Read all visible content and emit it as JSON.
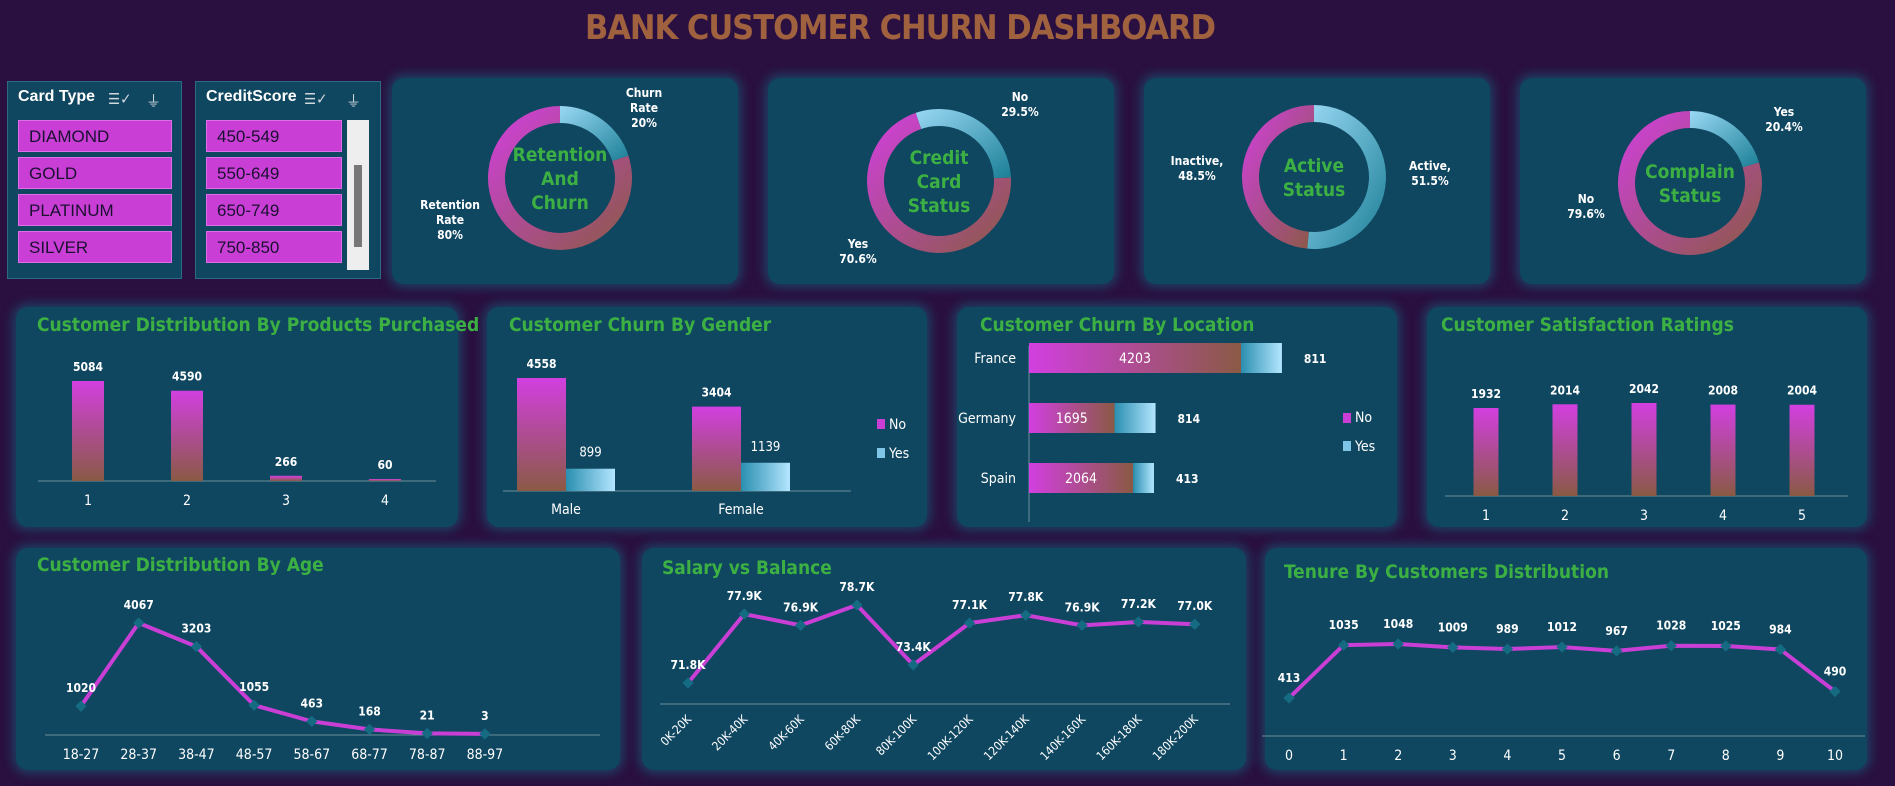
{
  "title": "BANK CUSTOMER CHURN DASHBOARD",
  "colors": {
    "background": "#2a1040",
    "card": "#0f4660",
    "title": "#a0613f",
    "chart_title": "#3cb043",
    "magenta": "#c93fd6",
    "blue": "#9ad8f5",
    "line": "#c93fd6",
    "marker": "#156b82"
  },
  "slicers": [
    {
      "title": "Card Type",
      "items": [
        "DIAMOND",
        "GOLD",
        "PLATINUM",
        "SILVER"
      ]
    },
    {
      "title": "CreditScore",
      "items": [
        "450-549",
        "550-649",
        "650-749",
        "750-850"
      ]
    }
  ],
  "chart_data": [
    {
      "type": "pie",
      "id": "retention",
      "center_title": [
        "Retention",
        "And",
        "Churn"
      ],
      "labels": [
        {
          "name": "Churn",
          "sub": "Rate",
          "value": "20%"
        },
        {
          "name": "Retention",
          "sub": "Rate",
          "value": "80%"
        }
      ],
      "values": [
        20,
        80
      ]
    },
    {
      "type": "pie",
      "id": "creditcard",
      "center_title": [
        "Credit",
        "Card",
        "Status"
      ],
      "labels": [
        {
          "name": "No",
          "value": "29.5%"
        },
        {
          "name": "Yes",
          "value": "70.6%"
        }
      ],
      "values": [
        29.5,
        70.6
      ]
    },
    {
      "type": "pie",
      "id": "active",
      "center_title": [
        "Active",
        "Status"
      ],
      "labels": [
        {
          "name": "Active,",
          "value": "51.5%"
        },
        {
          "name": "Inactive,",
          "value": "48.5%"
        }
      ],
      "values": [
        51.5,
        48.5
      ]
    },
    {
      "type": "pie",
      "id": "complain",
      "center_title": [
        "Complain",
        "Status"
      ],
      "labels": [
        {
          "name": "Yes",
          "value": "20.4%"
        },
        {
          "name": "No",
          "value": "79.6%"
        }
      ],
      "values": [
        20.4,
        79.6
      ]
    },
    {
      "type": "bar",
      "id": "products",
      "title": "Customer Distribution By Products Purchased",
      "categories": [
        "1",
        "2",
        "3",
        "4"
      ],
      "values": [
        5084,
        4590,
        266,
        60
      ]
    },
    {
      "type": "bar",
      "id": "gender",
      "title": "Customer Churn By Gender",
      "categories": [
        "Male",
        "Female"
      ],
      "series": [
        {
          "name": "No",
          "values": [
            4558,
            3404
          ]
        },
        {
          "name": "Yes",
          "values": [
            899,
            1139
          ]
        }
      ]
    },
    {
      "type": "bar",
      "id": "location",
      "title": "Customer Churn By Location",
      "orientation": "horizontal",
      "categories": [
        "France",
        "Germany",
        "Spain"
      ],
      "series": [
        {
          "name": "No",
          "values": [
            4203,
            1695,
            2064
          ]
        },
        {
          "name": "Yes",
          "values": [
            811,
            814,
            413
          ]
        }
      ]
    },
    {
      "type": "bar",
      "id": "satisfaction",
      "title": "Customer Satisfaction Ratings",
      "categories": [
        "1",
        "2",
        "3",
        "4",
        "5"
      ],
      "values": [
        1932,
        2014,
        2042,
        2008,
        2004
      ]
    },
    {
      "type": "line",
      "id": "age",
      "title": "Customer Distribution By Age",
      "categories": [
        "18-27",
        "28-37",
        "38-47",
        "48-57",
        "58-67",
        "68-77",
        "78-87",
        "88-97"
      ],
      "values": [
        1020,
        4067,
        3203,
        1055,
        463,
        168,
        21,
        3
      ]
    },
    {
      "type": "line",
      "id": "salary",
      "title": "Salary vs Balance",
      "categories": [
        "0K-20K",
        "20K-40K",
        "40K-60K",
        "60K-80K",
        "80K-100K",
        "100K-120K",
        "120K-140K",
        "140K-160K",
        "160K-180K",
        "180K-200K"
      ],
      "values": [
        71.8,
        77.9,
        76.9,
        78.7,
        73.4,
        77.1,
        77.8,
        76.9,
        77.2,
        77.0
      ],
      "labels": [
        "71.8K",
        "77.9K",
        "76.9K",
        "78.7K",
        "73.4K",
        "77.1K",
        "77.8K",
        "76.9K",
        "77.2K",
        "77.0K"
      ]
    },
    {
      "type": "line",
      "id": "tenure",
      "title": "Tenure By Customers Distribution",
      "categories": [
        "0",
        "1",
        "2",
        "3",
        "4",
        "5",
        "6",
        "7",
        "8",
        "9",
        "10"
      ],
      "values": [
        413,
        1035,
        1048,
        1009,
        989,
        1012,
        967,
        1028,
        1025,
        984,
        490
      ]
    }
  ]
}
